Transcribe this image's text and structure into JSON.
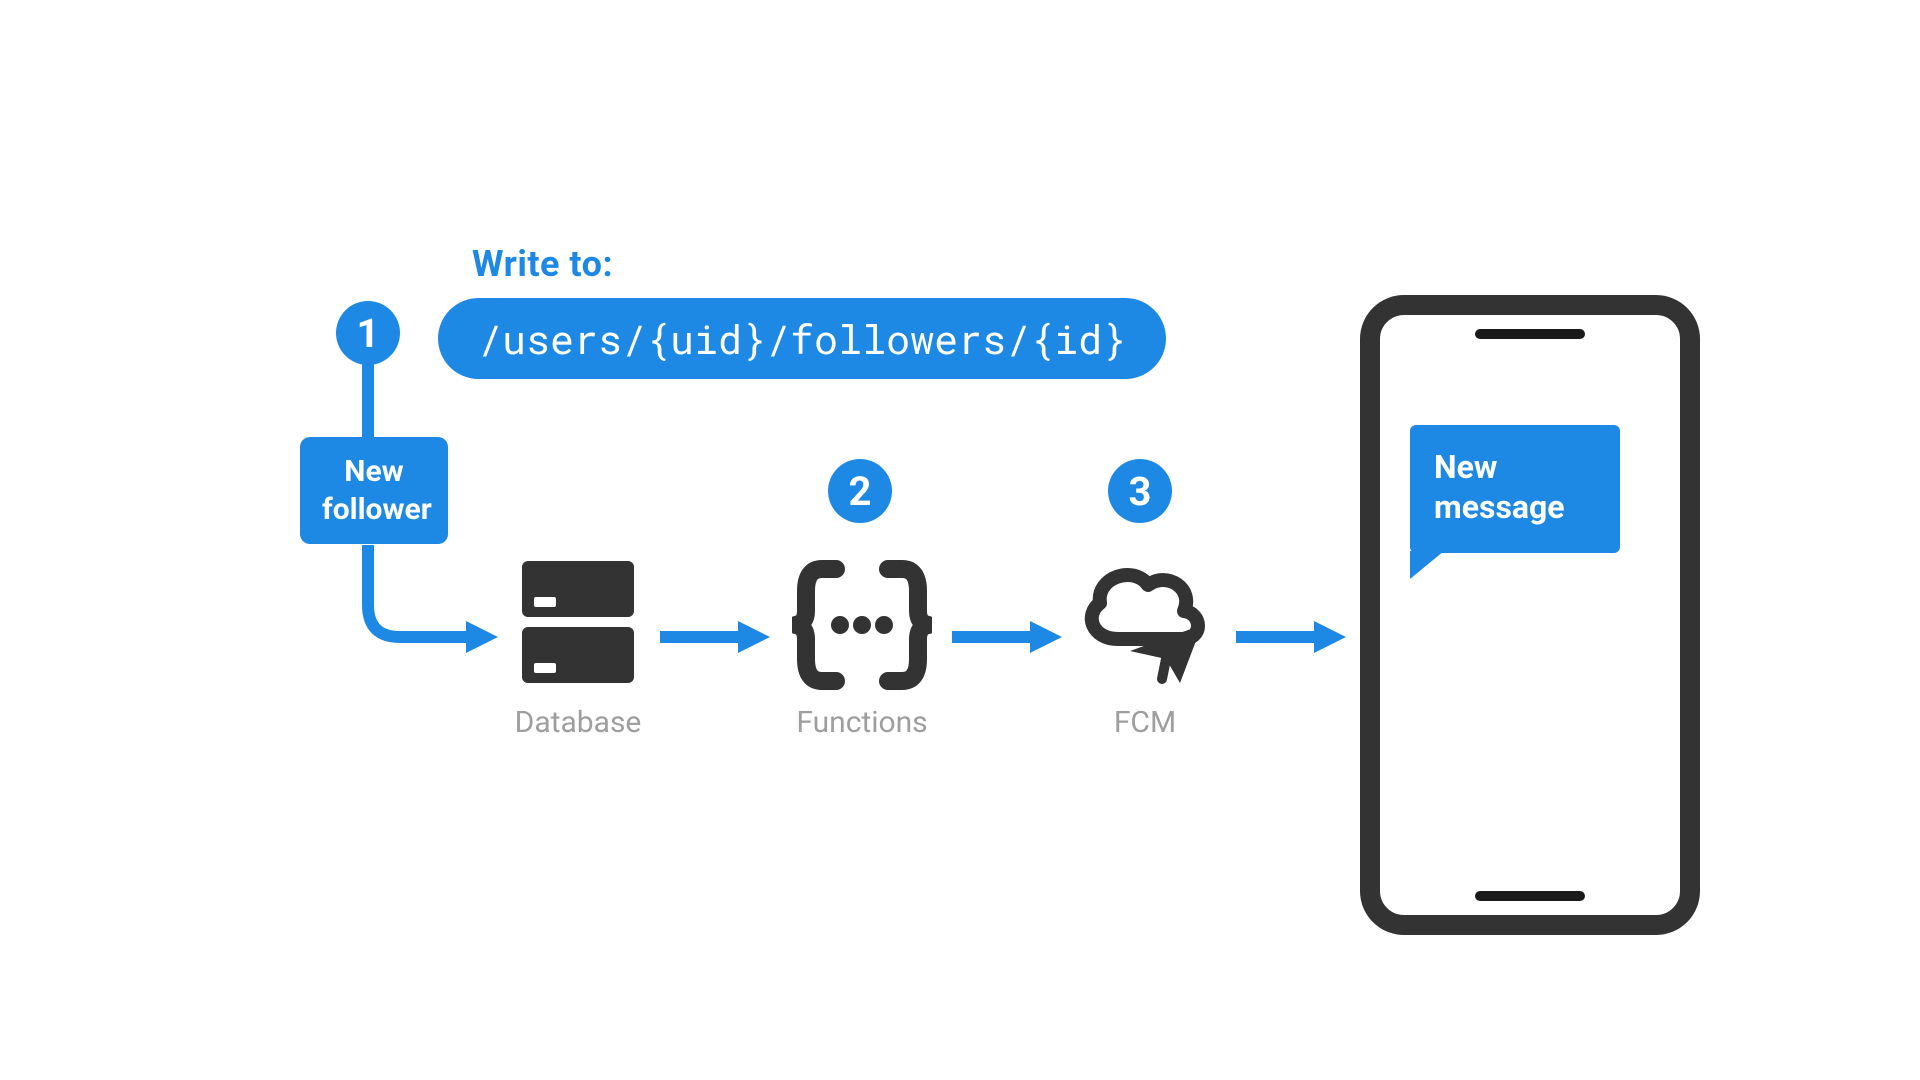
{
  "colors": {
    "accent": "#1E88E5",
    "icon": "#333333",
    "muted": "#9e9e9e"
  },
  "header": {
    "write_label": "Write to:",
    "path": "/users/{uid}/followers/{id}"
  },
  "steps": {
    "one": "1",
    "two": "2",
    "three": "3"
  },
  "trigger": {
    "label_line1": "New",
    "label_line2": "follower"
  },
  "services": {
    "database": {
      "label": "Database"
    },
    "functions": {
      "label": "Functions"
    },
    "fcm": {
      "label": "FCM"
    }
  },
  "phone": {
    "notification_line1": "New",
    "notification_line2": "message"
  }
}
